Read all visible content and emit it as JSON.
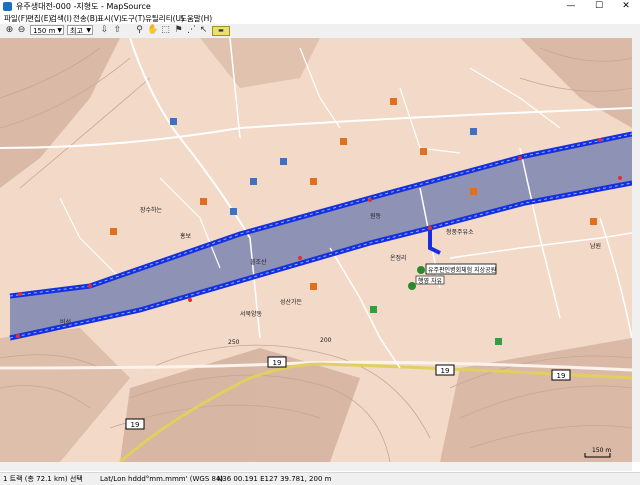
{
  "window": {
    "title": "유주생대전-000 -지형도 - MapSource",
    "minimize_glyph": "—",
    "maximize_glyph": "☐",
    "close_glyph": "✕"
  },
  "menu": [
    {
      "label": "파일(F)"
    },
    {
      "label": "편집(E)"
    },
    {
      "label": "검색(I)"
    },
    {
      "label": "전송(B)"
    },
    {
      "label": "표시(V)"
    },
    {
      "label": "도구(T)"
    },
    {
      "label": "유틸리티(U)"
    },
    {
      "label": "도움말(H)"
    }
  ],
  "toolbar": {
    "zoom_level": "150 m",
    "detail_level": "최고",
    "icons": [
      "zoom-in-icon",
      "zoom-out-icon",
      "receive-from-device-icon",
      "send-to-device-icon",
      "zoom-tool-icon",
      "hand-tool-icon",
      "selection-tool-icon",
      "waypoint-tool-icon",
      "route-tool-icon",
      "track-tool-icon",
      "pointer-tool-icon",
      "distance-tool-icon"
    ]
  },
  "map": {
    "road_shields": [
      "19",
      "19",
      "19",
      "19"
    ],
    "tooltip": {
      "line1": "유주판인병회체험 지상공원",
      "line2": "행영 자유"
    },
    "place_labels": [
      "성산가든",
      "250",
      "200",
      "장수하는",
      "불조산",
      "서북양동",
      "온정리",
      "청풍주유소",
      "비석",
      "남원",
      "홍보",
      "원동"
    ],
    "scale_label": "150 m",
    "colors": {
      "land": "#f2d9c8",
      "river": "#8e93b6",
      "track": "#1a2ee0",
      "road": "#ffffff",
      "contour": "#c8a890"
    }
  },
  "status": {
    "track": "1 트랙 (총 72.1 km) 선택",
    "format": "Lat/Lon hddd°mm.mmm' (WGS 84)",
    "coords": "N36 00.191 E127 39.781, 200 m"
  }
}
